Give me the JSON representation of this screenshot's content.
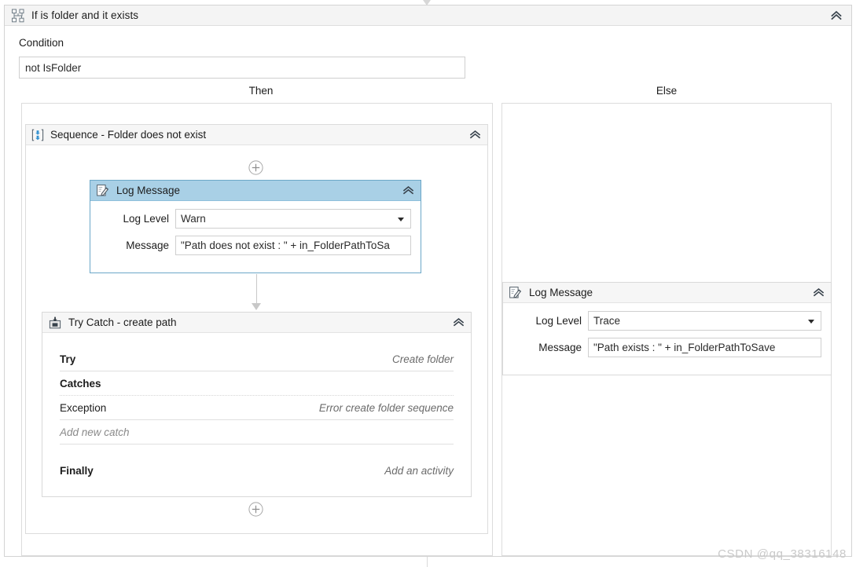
{
  "activity": {
    "title": "If is folder and it exists",
    "icon": "flow-decision-icon",
    "collapse_label": "collapse"
  },
  "condition": {
    "label": "Condition",
    "value": "not IsFolder",
    "placeholder": ""
  },
  "branches": {
    "then_label": "Then",
    "else_label": "Else"
  },
  "sequence": {
    "title": "Sequence - Folder does not exist",
    "icon": "sequence-icon",
    "add_top_label": "+",
    "add_bottom_label": "+"
  },
  "log_then": {
    "title": "Log Message",
    "icon": "log-message-icon",
    "level_label": "Log Level",
    "level_value": "Warn",
    "message_label": "Message",
    "message_value": "\"Path does not exist : \" + in_FolderPathToSa"
  },
  "log_else": {
    "title": "Log Message",
    "icon": "log-message-icon",
    "level_label": "Log Level",
    "level_value": "Trace",
    "message_label": "Message",
    "message_value": "\"Path exists : \" + in_FolderPathToSave"
  },
  "trycatch": {
    "title": "Try Catch - create path",
    "icon": "try-catch-icon",
    "try_label": "Try",
    "try_value": "Create folder",
    "catches_label": "Catches",
    "exception_label": "Exception",
    "exception_value": "Error create folder sequence",
    "add_new_catch": "Add new catch",
    "finally_label": "Finally",
    "finally_value": "Add an activity"
  },
  "watermark": {
    "text": "CSDN @qq_38316148"
  },
  "colors": {
    "selected_header": "#a9d0e6",
    "selected_border": "#6ba7c8",
    "panel_border": "#dcdcdc",
    "header_bg": "#f4f4f4",
    "accent_blue": "#2f8fd0"
  }
}
